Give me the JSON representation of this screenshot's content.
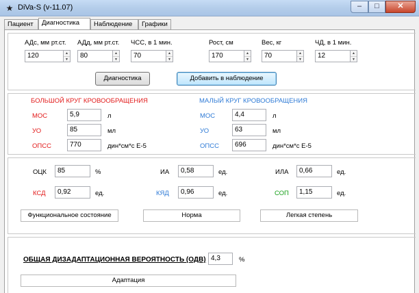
{
  "window": {
    "title": "DiVa-S (v-11.07)",
    "icon": "app-icon",
    "controls": [
      "minimize-icon",
      "maximize-icon",
      "close-icon"
    ]
  },
  "tabs": [
    {
      "label": "Пациент",
      "active": false
    },
    {
      "label": "Диагностика",
      "active": true
    },
    {
      "label": "Наблюдение",
      "active": false
    },
    {
      "label": "Графики",
      "active": false
    }
  ],
  "inputs": {
    "ad_s": {
      "label": "АДс, мм рт.ст.",
      "value": "120"
    },
    "ad_d": {
      "label": "АДд, мм рт.ст.",
      "value": "80"
    },
    "chss": {
      "label": "ЧСС, в 1 мин.",
      "value": "70"
    },
    "height": {
      "label": "Рост, см",
      "value": "170"
    },
    "weight": {
      "label": "Вес, кг",
      "value": "70"
    },
    "chd": {
      "label": "ЧД, в 1 мин.",
      "value": "12"
    }
  },
  "buttons": {
    "diagnostics": "Диагностика",
    "add_to_observation": "Добавить в наблюдение"
  },
  "circulation": {
    "big": {
      "title": "БОЛЬШОЙ КРУГ КРОВООБРАЩЕНИЯ",
      "rows": [
        {
          "label": "МОС",
          "value": "5,9",
          "unit": "л"
        },
        {
          "label": "УО",
          "value": "85",
          "unit": "мл"
        },
        {
          "label": "ОПСС",
          "value": "770",
          "unit": "дин*см*с Е-5"
        }
      ]
    },
    "small": {
      "title": "МАЛЫЙ КРУГ КРОВООБРАЩЕНИЯ",
      "rows": [
        {
          "label": "МОС",
          "value": "4,4",
          "unit": "л"
        },
        {
          "label": "УО",
          "value": "63",
          "unit": "мл"
        },
        {
          "label": "ОПСС",
          "value": "696",
          "unit": "дин*см*с Е-5"
        }
      ]
    }
  },
  "indices": {
    "ocz": {
      "label": "ОЦК",
      "value": "85",
      "unit": "%"
    },
    "ia": {
      "label": "ИА",
      "value": "0,58",
      "unit": "ед."
    },
    "ila": {
      "label": "ИЛА",
      "value": "0,66",
      "unit": "ед."
    },
    "ksd": {
      "label": "КСД",
      "value": "0,92",
      "unit": "ед."
    },
    "kyad": {
      "label": "КЯД",
      "value": "0,96",
      "unit": "ед."
    },
    "sop": {
      "label": "СОП",
      "value": "1,15",
      "unit": "ед."
    }
  },
  "status_boxes": {
    "functional": "Функциональное состояние",
    "norm": "Норма",
    "degree": "Легкая степень"
  },
  "odv": {
    "label": "ОБЩАЯ ДИЗАДАПТАЦИОННАЯ ВЕРОЯТНОСТЬ (ОДВ)",
    "value": "4,3",
    "unit": "%",
    "result": "Адаптация"
  },
  "colors": {
    "big_circle": "#e21b1b",
    "small_circle": "#2f7bd6",
    "ksd": "#e21b1b",
    "kyad": "#2f7bd6",
    "sop": "#17a01a"
  }
}
